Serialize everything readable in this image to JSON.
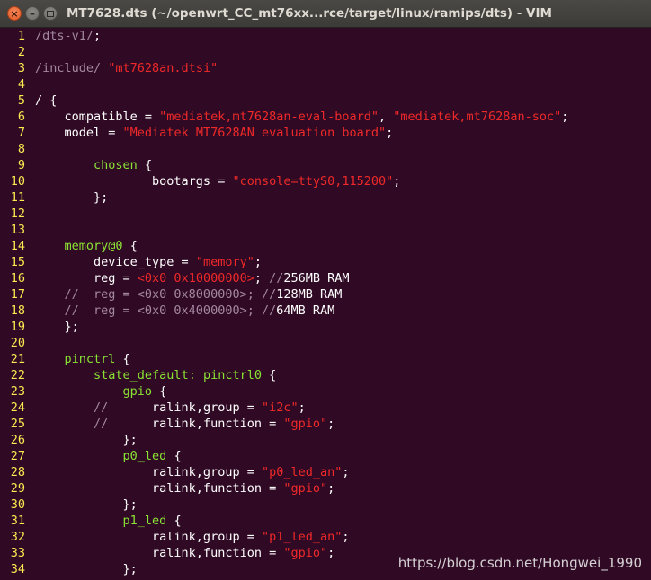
{
  "window": {
    "title": "MT7628.dts (~/openwrt_CC_mt76xx...rce/target/linux/ramips/dts) - VIM",
    "buttons": {
      "close": "×",
      "minimize": "–",
      "maximize": ""
    }
  },
  "colors": {
    "background": "#300a24",
    "line_number": "#fce94f",
    "comment": "#a487a0",
    "string": "#ef2929",
    "identifier": "#8ae234",
    "text": "#ffffff"
  },
  "editor": {
    "lines": [
      {
        "num": "1",
        "segments": [
          {
            "t": "/dts-v1/",
            "c": "comment"
          },
          {
            "t": ";",
            "c": "white"
          }
        ]
      },
      {
        "num": "2",
        "segments": []
      },
      {
        "num": "3",
        "segments": [
          {
            "t": "/include/ ",
            "c": "comment"
          },
          {
            "t": "\"mt7628an.dtsi\"",
            "c": "string"
          }
        ]
      },
      {
        "num": "4",
        "segments": []
      },
      {
        "num": "5",
        "segments": [
          {
            "t": "/ {",
            "c": "white"
          }
        ]
      },
      {
        "num": "6",
        "segments": [
          {
            "t": "    compatible = ",
            "c": "white"
          },
          {
            "t": "\"mediatek,mt7628an-eval-board\"",
            "c": "string"
          },
          {
            "t": ", ",
            "c": "white"
          },
          {
            "t": "\"mediatek,mt7628an-soc\"",
            "c": "string"
          },
          {
            "t": ";",
            "c": "white"
          }
        ]
      },
      {
        "num": "7",
        "segments": [
          {
            "t": "    model = ",
            "c": "white"
          },
          {
            "t": "\"Mediatek MT7628AN evaluation board\"",
            "c": "string"
          },
          {
            "t": ";",
            "c": "white"
          }
        ]
      },
      {
        "num": "8",
        "segments": []
      },
      {
        "num": "9",
        "segments": [
          {
            "t": "        ",
            "c": "white"
          },
          {
            "t": "chosen",
            "c": "green"
          },
          {
            "t": " {",
            "c": "white"
          }
        ]
      },
      {
        "num": "10",
        "segments": [
          {
            "t": "                bootargs = ",
            "c": "white"
          },
          {
            "t": "\"console=ttyS0,115200\"",
            "c": "string"
          },
          {
            "t": ";",
            "c": "white"
          }
        ]
      },
      {
        "num": "11",
        "segments": [
          {
            "t": "        };",
            "c": "white"
          }
        ]
      },
      {
        "num": "12",
        "segments": []
      },
      {
        "num": "13",
        "segments": []
      },
      {
        "num": "14",
        "segments": [
          {
            "t": "    ",
            "c": "white"
          },
          {
            "t": "memory@0",
            "c": "green"
          },
          {
            "t": " {",
            "c": "white"
          }
        ]
      },
      {
        "num": "15",
        "segments": [
          {
            "t": "        device_type = ",
            "c": "white"
          },
          {
            "t": "\"memory\"",
            "c": "string"
          },
          {
            "t": ";",
            "c": "white"
          }
        ]
      },
      {
        "num": "16",
        "segments": [
          {
            "t": "        reg = ",
            "c": "white"
          },
          {
            "t": "<0x0 0x10000000>",
            "c": "string"
          },
          {
            "t": "; ",
            "c": "white"
          },
          {
            "t": "//",
            "c": "comment"
          },
          {
            "t": "256MB RAM",
            "c": "white"
          }
        ]
      },
      {
        "num": "17",
        "segments": [
          {
            "t": "    //  reg = <0x0 0x8000000>; //",
            "c": "comment"
          },
          {
            "t": "128MB RAM",
            "c": "white"
          }
        ]
      },
      {
        "num": "18",
        "segments": [
          {
            "t": "    //  reg = <0x0 0x4000000>; //",
            "c": "comment"
          },
          {
            "t": "64MB RAM",
            "c": "white"
          }
        ]
      },
      {
        "num": "19",
        "segments": [
          {
            "t": "    };",
            "c": "white"
          }
        ]
      },
      {
        "num": "20",
        "segments": []
      },
      {
        "num": "21",
        "segments": [
          {
            "t": "    ",
            "c": "white"
          },
          {
            "t": "pinctrl",
            "c": "green"
          },
          {
            "t": " {",
            "c": "white"
          }
        ]
      },
      {
        "num": "22",
        "segments": [
          {
            "t": "        ",
            "c": "white"
          },
          {
            "t": "state_default: pinctrl0",
            "c": "green"
          },
          {
            "t": " {",
            "c": "white"
          }
        ]
      },
      {
        "num": "23",
        "segments": [
          {
            "t": "            ",
            "c": "white"
          },
          {
            "t": "gpio",
            "c": "green"
          },
          {
            "t": " {",
            "c": "white"
          }
        ]
      },
      {
        "num": "24",
        "segments": [
          {
            "t": "        //      ",
            "c": "comment"
          },
          {
            "t": "ralink,group = ",
            "c": "white"
          },
          {
            "t": "\"i2c\"",
            "c": "string"
          },
          {
            "t": ";",
            "c": "white"
          }
        ]
      },
      {
        "num": "25",
        "segments": [
          {
            "t": "        //      ",
            "c": "comment"
          },
          {
            "t": "ralink,function = ",
            "c": "white"
          },
          {
            "t": "\"gpio\"",
            "c": "string"
          },
          {
            "t": ";",
            "c": "white"
          }
        ]
      },
      {
        "num": "26",
        "segments": [
          {
            "t": "            };",
            "c": "white"
          }
        ]
      },
      {
        "num": "27",
        "segments": [
          {
            "t": "            ",
            "c": "white"
          },
          {
            "t": "p0_led",
            "c": "green"
          },
          {
            "t": " {",
            "c": "white"
          }
        ]
      },
      {
        "num": "28",
        "segments": [
          {
            "t": "                ralink,group = ",
            "c": "white"
          },
          {
            "t": "\"p0_led_an\"",
            "c": "string"
          },
          {
            "t": ";",
            "c": "white"
          }
        ]
      },
      {
        "num": "29",
        "segments": [
          {
            "t": "                ralink,function = ",
            "c": "white"
          },
          {
            "t": "\"gpio\"",
            "c": "string"
          },
          {
            "t": ";",
            "c": "white"
          }
        ]
      },
      {
        "num": "30",
        "segments": [
          {
            "t": "            };",
            "c": "white"
          }
        ]
      },
      {
        "num": "31",
        "segments": [
          {
            "t": "            ",
            "c": "white"
          },
          {
            "t": "p1_led",
            "c": "green"
          },
          {
            "t": " {",
            "c": "white"
          }
        ]
      },
      {
        "num": "32",
        "segments": [
          {
            "t": "                ralink,group = ",
            "c": "white"
          },
          {
            "t": "\"p1_led_an\"",
            "c": "string"
          },
          {
            "t": ";",
            "c": "white"
          }
        ]
      },
      {
        "num": "33",
        "segments": [
          {
            "t": "                ralink,function = ",
            "c": "white"
          },
          {
            "t": "\"gpio\"",
            "c": "string"
          },
          {
            "t": ";",
            "c": "white"
          }
        ]
      },
      {
        "num": "34",
        "segments": [
          {
            "t": "            };",
            "c": "white"
          }
        ]
      }
    ]
  },
  "watermark": "https://blog.csdn.net/Hongwei_1990"
}
